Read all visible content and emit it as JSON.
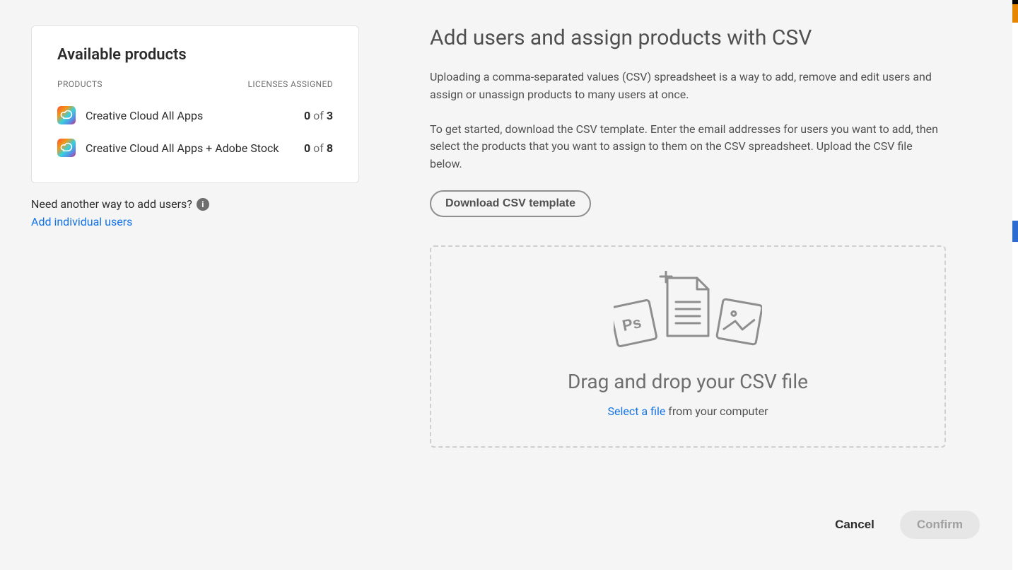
{
  "sidebar": {
    "card_title": "Available products",
    "col_products": "PRODUCTS",
    "col_licenses": "LICENSES ASSIGNED",
    "products": [
      {
        "name": "Creative Cloud All Apps",
        "used": "0",
        "sep": "of",
        "total": "3"
      },
      {
        "name": "Creative Cloud All Apps + Adobe Stock",
        "used": "0",
        "sep": "of",
        "total": "8"
      }
    ],
    "need_text": "Need another way to add users?",
    "add_link": "Add individual users"
  },
  "main": {
    "title": "Add users and assign products with CSV",
    "para1": "Uploading a comma-separated values (CSV) spreadsheet is a way to add, remove and edit users and assign or unassign products to many users at once.",
    "para2": "To get started, download the CSV template. Enter the email addresses for users you want to add, then select the products that you want to assign to them on the CSV spreadsheet. Upload the CSV file below.",
    "download_btn": "Download CSV template",
    "drop_title": "Drag and drop your CSV file",
    "select_file": "Select a file",
    "from_computer": " from your computer"
  },
  "footer": {
    "cancel": "Cancel",
    "confirm": "Confirm"
  }
}
